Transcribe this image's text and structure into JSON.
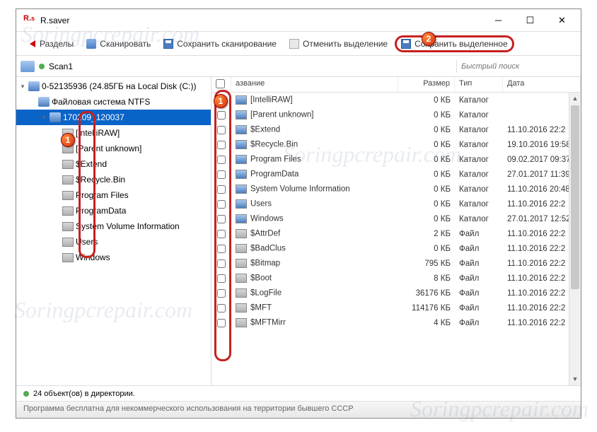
{
  "window": {
    "title": "R.saver",
    "logo_text_a": "R.",
    "logo_text_b": "s"
  },
  "toolbar": {
    "back": "Разделы",
    "scan": "Сканировать",
    "save_scan": "Сохранить сканирование",
    "deselect": "Отменить выделение",
    "save_selected": "Сохранить выделенное"
  },
  "pathbar": {
    "path": "Scan1",
    "search_placeholder": "Быстрый поиск"
  },
  "tree": {
    "root": "0-52135936 (24.85ГБ на Local Disk (C:))",
    "fs": "Файловая система NTFS",
    "scan": "170209_120037",
    "children": [
      "[IntelliRAW]",
      "[Parent unknown]",
      "$Extend",
      "$Recycle.Bin",
      "Program Files",
      "ProgramData",
      "System Volume Information",
      "Users",
      "Windows"
    ]
  },
  "columns": {
    "name": "азвание",
    "size": "Размер",
    "type": "Тип",
    "date": "Дата"
  },
  "files": [
    {
      "n": "[IntelliRAW]",
      "s": "0 КБ",
      "t": "Каталог",
      "d": "",
      "folder": true
    },
    {
      "n": "[Parent unknown]",
      "s": "0 КБ",
      "t": "Каталог",
      "d": "",
      "folder": true
    },
    {
      "n": "$Extend",
      "s": "0 КБ",
      "t": "Каталог",
      "d": "11.10.2016 22:2",
      "folder": true
    },
    {
      "n": "$Recycle.Bin",
      "s": "0 КБ",
      "t": "Каталог",
      "d": "19.10.2016 19:58",
      "folder": true
    },
    {
      "n": "Program Files",
      "s": "0 КБ",
      "t": "Каталог",
      "d": "09.02.2017 09:37",
      "folder": true
    },
    {
      "n": "ProgramData",
      "s": "0 КБ",
      "t": "Каталог",
      "d": "27.01.2017 11:39",
      "folder": true
    },
    {
      "n": "System Volume Information",
      "s": "0 КБ",
      "t": "Каталог",
      "d": "11.10.2016 20:48",
      "folder": true
    },
    {
      "n": "Users",
      "s": "0 КБ",
      "t": "Каталог",
      "d": "11.10.2016 22:2",
      "folder": true
    },
    {
      "n": "Windows",
      "s": "0 КБ",
      "t": "Каталог",
      "d": "27.01.2017 12:52",
      "folder": true
    },
    {
      "n": "$AttrDef",
      "s": "2 КБ",
      "t": "Файл",
      "d": "11.10.2016 22:2",
      "folder": false
    },
    {
      "n": "$BadClus",
      "s": "0 КБ",
      "t": "Файл",
      "d": "11.10.2016 22:2",
      "folder": false
    },
    {
      "n": "$Bitmap",
      "s": "795 КБ",
      "t": "Файл",
      "d": "11.10.2016 22:2",
      "folder": false
    },
    {
      "n": "$Boot",
      "s": "8 КБ",
      "t": "Файл",
      "d": "11.10.2016 22:2",
      "folder": false
    },
    {
      "n": "$LogFile",
      "s": "36176 КБ",
      "t": "Файл",
      "d": "11.10.2016 22:2",
      "folder": false
    },
    {
      "n": "$MFT",
      "s": "114176 КБ",
      "t": "Файл",
      "d": "11.10.2016 22:2",
      "folder": false
    },
    {
      "n": "$MFTMirr",
      "s": "4 КБ",
      "t": "Файл",
      "d": "11.10.2016 22:2",
      "folder": false
    }
  ],
  "status": "24 объект(ов) в директории.",
  "footer": "Программа бесплатна для некоммерческого использования на территории бывшего СССР",
  "callouts": {
    "one": "1",
    "two": "2"
  },
  "watermark": "Soringpcrepair.com"
}
